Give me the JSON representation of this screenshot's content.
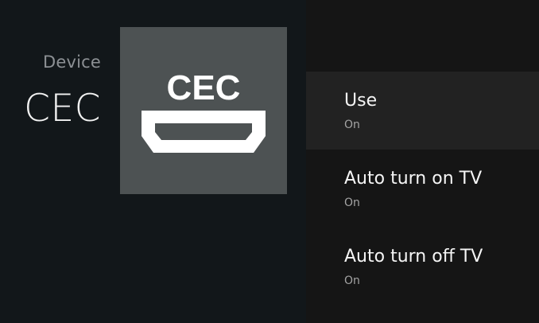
{
  "header": {
    "breadcrumb": "Device",
    "title": "CEC"
  },
  "hero": {
    "icon": "hdmi-cec-icon",
    "label": "CEC",
    "background": "#4d5253"
  },
  "preferences": [
    {
      "title": "Use",
      "summary": "On",
      "focused": true
    },
    {
      "title": "Auto turn on TV",
      "summary": "On",
      "focused": false
    },
    {
      "title": "Auto turn off TV",
      "summary": "On",
      "focused": false
    }
  ],
  "colors": {
    "background": "#12171a",
    "list_background": "#151515",
    "focused_row": "#222222"
  }
}
